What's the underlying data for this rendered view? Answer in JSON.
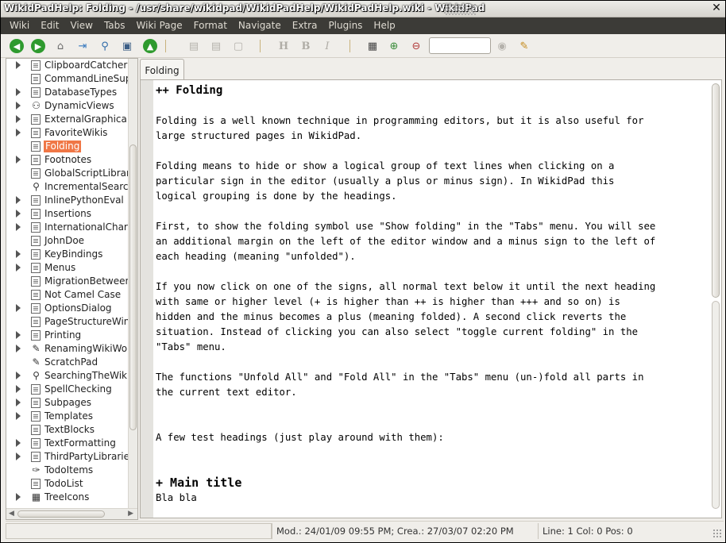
{
  "window": {
    "title": "WikidPadHelp: Folding - /usr/share/wikidpad/WikidPadHelp/WikidPadHelp.wiki - WikidPad",
    "close_glyph": "✕"
  },
  "menu": [
    "Wiki",
    "Edit",
    "View",
    "Tabs",
    "Wiki Page",
    "Format",
    "Navigate",
    "Extra",
    "Plugins",
    "Help"
  ],
  "toolbar": {
    "search_value": "",
    "bold_label": "H",
    "b_label": "B",
    "italic_label": "I",
    "icons": [
      "back-icon",
      "forward-icon",
      "home-icon",
      "open-wiki-icon",
      "search-icon",
      "search-page-icon",
      "refresh-icon",
      "copy-icon",
      "paste-icon",
      "clipboard-icon",
      "heading-icon",
      "bold-icon",
      "italic-icon",
      "calendar-icon",
      "zoom-in-icon",
      "zoom-out-icon",
      "search-go-icon",
      "edit-icon"
    ]
  },
  "tree": [
    {
      "label": "ClipboardCatcher",
      "expandable": true,
      "icon": "page"
    },
    {
      "label": "CommandLineSupp",
      "expandable": false,
      "icon": "page"
    },
    {
      "label": "DatabaseTypes",
      "expandable": true,
      "icon": "page"
    },
    {
      "label": "DynamicViews",
      "expandable": true,
      "icon": "binoculars"
    },
    {
      "label": "ExternalGraphicalA",
      "expandable": true,
      "icon": "page"
    },
    {
      "label": "FavoriteWikis",
      "expandable": true,
      "icon": "page"
    },
    {
      "label": "Folding",
      "expandable": false,
      "icon": "page",
      "selected": true
    },
    {
      "label": "Footnotes",
      "expandable": true,
      "icon": "page"
    },
    {
      "label": "GlobalScriptLibrary",
      "expandable": false,
      "icon": "page"
    },
    {
      "label": "IncrementalSearch",
      "expandable": false,
      "icon": "magnifier"
    },
    {
      "label": "InlinePythonEval",
      "expandable": true,
      "icon": "page"
    },
    {
      "label": "Insertions",
      "expandable": true,
      "icon": "page"
    },
    {
      "label": "InternationalChara",
      "expandable": true,
      "icon": "page"
    },
    {
      "label": "JohnDoe",
      "expandable": false,
      "icon": "page"
    },
    {
      "label": "KeyBindings",
      "expandable": true,
      "icon": "page"
    },
    {
      "label": "Menus",
      "expandable": true,
      "icon": "page"
    },
    {
      "label": "MigrationBetween",
      "expandable": false,
      "icon": "page"
    },
    {
      "label": "Not Camel Case",
      "expandable": false,
      "icon": "page"
    },
    {
      "label": "OptionsDialog",
      "expandable": true,
      "icon": "page"
    },
    {
      "label": "PageStructureWin",
      "expandable": false,
      "icon": "page"
    },
    {
      "label": "Printing",
      "expandable": true,
      "icon": "page"
    },
    {
      "label": "RenamingWikiWor",
      "expandable": true,
      "icon": "pencil"
    },
    {
      "label": "ScratchPad",
      "expandable": false,
      "icon": "pencil"
    },
    {
      "label": "SearchingTheWiki",
      "expandable": true,
      "icon": "magnifier"
    },
    {
      "label": "SpellChecking",
      "expandable": true,
      "icon": "page"
    },
    {
      "label": "Subpages",
      "expandable": true,
      "icon": "page"
    },
    {
      "label": "Templates",
      "expandable": true,
      "icon": "page"
    },
    {
      "label": "TextBlocks",
      "expandable": false,
      "icon": "page"
    },
    {
      "label": "TextFormatting",
      "expandable": true,
      "icon": "page"
    },
    {
      "label": "ThirdPartyLibraries",
      "expandable": true,
      "icon": "page"
    },
    {
      "label": "TodoItems",
      "expandable": false,
      "icon": "pin"
    },
    {
      "label": "TodoList",
      "expandable": false,
      "icon": "page"
    },
    {
      "label": "TreeIcons",
      "expandable": true,
      "icon": "grid"
    }
  ],
  "tabs": [
    {
      "label": "Folding"
    }
  ],
  "editor": {
    "lines": [
      {
        "text": "++ Folding",
        "style": "h2"
      },
      {
        "text": ""
      },
      {
        "text": "Folding is a well known technique in programming editors, but it is also useful for"
      },
      {
        "text": "large structured pages in WikidPad."
      },
      {
        "text": ""
      },
      {
        "text": "Folding means to hide or show a logical group of text lines when clicking on a"
      },
      {
        "text": "particular sign in the editor (usually a plus or minus sign). In WikidPad this"
      },
      {
        "text": "logical grouping is done by the headings."
      },
      {
        "text": ""
      },
      {
        "text": "First, to show the folding symbol use \"Show folding\" in the \"Tabs\" menu. You will see"
      },
      {
        "text": "an additional margin on the left of the editor window and a minus sign to the left of"
      },
      {
        "text": "each heading (meaning \"unfolded\")."
      },
      {
        "text": ""
      },
      {
        "text": "If you now click on one of the signs, all normal text below it until the next heading"
      },
      {
        "text": "with same or higher level (+ is higher than ++ is higher than +++ and so on) is"
      },
      {
        "text": "hidden and the minus becomes a plus (meaning folded). A second click reverts the"
      },
      {
        "text": "situation. Instead of clicking you can also select \"toggle current folding\" in the"
      },
      {
        "text": "\"Tabs\" menu."
      },
      {
        "text": ""
      },
      {
        "text": "The functions \"Unfold All\" and \"Fold All\" in the \"Tabs\" menu (un-)fold all parts in"
      },
      {
        "text": "the current text editor."
      },
      {
        "text": ""
      },
      {
        "text": ""
      },
      {
        "text": "A few test headings (just play around with them):"
      },
      {
        "text": ""
      },
      {
        "text": ""
      },
      {
        "text": "+ Main title",
        "style": "h1"
      },
      {
        "text": "Bla bla"
      }
    ]
  },
  "status": {
    "left": "",
    "mod": "Mod.: 24/01/09 09:55 PM; Crea.: 27/03/07 02:20 PM",
    "pos": "Line: 1 Col: 0 Pos: 0"
  }
}
